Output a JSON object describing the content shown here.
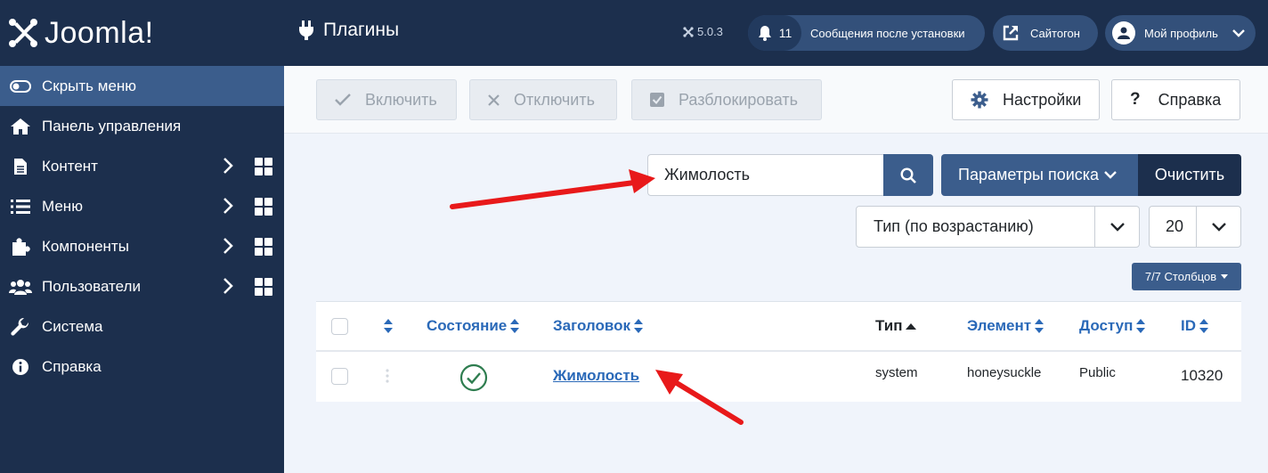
{
  "brand": {
    "name": "Joomla!"
  },
  "sidebar": {
    "items": [
      {
        "label": "Скрыть меню",
        "icon": "toggle-icon"
      },
      {
        "label": "Панель управления",
        "icon": "home-icon"
      },
      {
        "label": "Контент",
        "icon": "file-icon"
      },
      {
        "label": "Меню",
        "icon": "list-icon"
      },
      {
        "label": "Компоненты",
        "icon": "puzzle-icon"
      },
      {
        "label": "Пользователи",
        "icon": "users-icon"
      },
      {
        "label": "Система",
        "icon": "wrench-icon"
      },
      {
        "label": "Справка",
        "icon": "info-icon"
      }
    ]
  },
  "header": {
    "title": "Плагины",
    "version": "5.0.3",
    "notifications": {
      "count": "11",
      "label": "Сообщения после установки"
    },
    "site_label": "Сайтогон",
    "profile_label": "Мой профиль"
  },
  "toolbar": {
    "enable": "Включить",
    "disable": "Отключить",
    "unlock": "Разблокировать",
    "options": "Настройки",
    "help": "Справка"
  },
  "search": {
    "value": "Жимолость",
    "tools_label": "Параметры поиска",
    "clear_label": "Очистить"
  },
  "sorting": {
    "order": "Тип (по возрастанию)",
    "limit": "20"
  },
  "columns_button": "7/7 Столбцов",
  "table": {
    "headers": {
      "status": "Состояние",
      "title": "Заголовок",
      "type": "Тип",
      "element": "Элемент",
      "access": "Доступ",
      "id": "ID"
    },
    "rows": [
      {
        "title": "Жимолость",
        "type": "system",
        "element": "honeysuckle",
        "access": "Public",
        "id": "10320"
      }
    ]
  },
  "colors": {
    "sidebar_bg": "#1c2f4d",
    "accent": "#3b5d8c",
    "link": "#2a69b8",
    "success": "#2e7d4f",
    "annotation_arrow": "#e8191a"
  }
}
